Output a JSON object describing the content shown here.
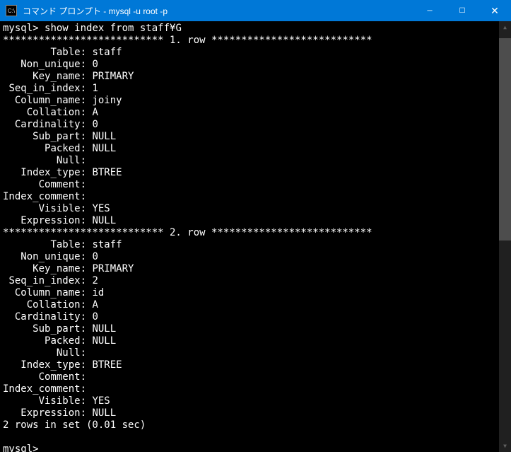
{
  "titlebar": {
    "icon_label": "C:\\",
    "title": "コマンド プロンプト - mysql  -u root -p"
  },
  "win_controls": {
    "minimize": "─",
    "maximize": "☐",
    "close": "✕"
  },
  "terminal": {
    "prompt1": "mysql> ",
    "command1": "show index from staff¥G",
    "row1_header": "*************************** 1. row ***************************",
    "row2_header": "*************************** 2. row ***************************",
    "fields": {
      "Table": "Table",
      "Non_unique": "Non_unique",
      "Key_name": "Key_name",
      "Seq_in_index": "Seq_in_index",
      "Column_name": "Column_name",
      "Collation": "Collation",
      "Cardinality": "Cardinality",
      "Sub_part": "Sub_part",
      "Packed": "Packed",
      "Null": "Null",
      "Index_type": "Index_type",
      "Comment": "Comment",
      "Index_comment": "Index_comment",
      "Visible": "Visible",
      "Expression": "Expression"
    },
    "row1": {
      "Table": "staff",
      "Non_unique": "0",
      "Key_name": "PRIMARY",
      "Seq_in_index": "1",
      "Column_name": "joiny",
      "Collation": "A",
      "Cardinality": "0",
      "Sub_part": "NULL",
      "Packed": "NULL",
      "Null": "",
      "Index_type": "BTREE",
      "Comment": "",
      "Index_comment": "",
      "Visible": "YES",
      "Expression": "NULL"
    },
    "row2": {
      "Table": "staff",
      "Non_unique": "0",
      "Key_name": "PRIMARY",
      "Seq_in_index": "2",
      "Column_name": "id",
      "Collation": "A",
      "Cardinality": "0",
      "Sub_part": "NULL",
      "Packed": "NULL",
      "Null": "",
      "Index_type": "BTREE",
      "Comment": "",
      "Index_comment": "",
      "Visible": "YES",
      "Expression": "NULL"
    },
    "summary": "2 rows in set (0.01 sec)",
    "prompt2": "mysql> "
  }
}
